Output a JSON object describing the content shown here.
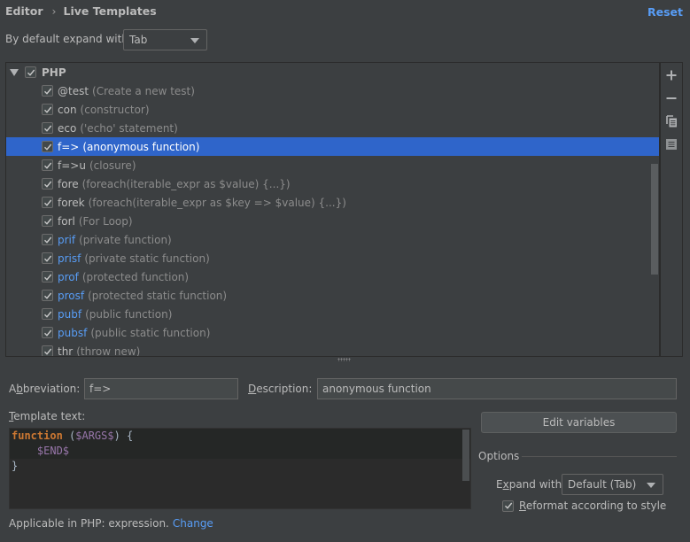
{
  "header": {
    "breadcrumb": [
      "Editor",
      "Live Templates"
    ],
    "separator": "›",
    "reset_label": "Reset"
  },
  "default_expand": {
    "label": "By default expand with",
    "value": "Tab"
  },
  "tree": {
    "group": {
      "label": "PHP",
      "expanded": true,
      "checked": true
    },
    "items": [
      {
        "abbr": "@test",
        "desc": "(Create a new test)",
        "checked": true,
        "color": "default"
      },
      {
        "abbr": "con",
        "desc": "(constructor)",
        "checked": true,
        "color": "default"
      },
      {
        "abbr": "eco",
        "desc": "('echo' statement)",
        "checked": true,
        "color": "default"
      },
      {
        "abbr": "f=>",
        "desc": "(anonymous function)",
        "checked": true,
        "color": "default",
        "selected": true
      },
      {
        "abbr": "f=>u",
        "desc": "(closure)",
        "checked": true,
        "color": "default"
      },
      {
        "abbr": "fore",
        "desc": "(foreach(iterable_expr as $value) {...})",
        "checked": true,
        "color": "default"
      },
      {
        "abbr": "forek",
        "desc": "(foreach(iterable_expr as $key => $value) {...})",
        "checked": true,
        "color": "default"
      },
      {
        "abbr": "forl",
        "desc": "(For Loop)",
        "checked": true,
        "color": "default"
      },
      {
        "abbr": "prif",
        "desc": "(private function)",
        "checked": true,
        "color": "blue"
      },
      {
        "abbr": "prisf",
        "desc": "(private static function)",
        "checked": true,
        "color": "blue"
      },
      {
        "abbr": "prof",
        "desc": "(protected function)",
        "checked": true,
        "color": "blue"
      },
      {
        "abbr": "prosf",
        "desc": "(protected static function)",
        "checked": true,
        "color": "blue"
      },
      {
        "abbr": "pubf",
        "desc": "(public function)",
        "checked": true,
        "color": "blue"
      },
      {
        "abbr": "pubsf",
        "desc": "(public static function)",
        "checked": true,
        "color": "blue"
      },
      {
        "abbr": "thr",
        "desc": "(throw new)",
        "checked": true,
        "color": "default"
      }
    ]
  },
  "toolbar": {
    "add_icon": "plus-icon",
    "remove_icon": "minus-icon",
    "copy_icon": "copy-icon",
    "restore_icon": "restore-icon"
  },
  "details": {
    "abbreviation_label_pre": "A",
    "abbreviation_label_u": "b",
    "abbreviation_label_post": "breviation:",
    "abbreviation_value": "f=>",
    "description_label_u": "D",
    "description_label_post": "escription:",
    "description_value": "anonymous function",
    "template_text_label_u": "T",
    "template_text_label_post": "emplate text:",
    "template_lines": {
      "l1_kw": "function",
      "l1_open": " (",
      "l1_var": "$ARGS$",
      "l1_close": ") {",
      "l2_indent": "    ",
      "l2_var": "$END$",
      "l3": "}"
    },
    "edit_variables_label": "Edit variables",
    "options_title": "Options",
    "expand_with_label_pre": "E",
    "expand_with_label_u": "x",
    "expand_with_label_post": "pand with",
    "expand_with_value": "Default (Tab)",
    "reformat_label_u": "R",
    "reformat_label_post": "eformat according to style",
    "reformat_checked": true,
    "applicable_text": "Applicable in PHP: expression.",
    "change_label": "Change"
  },
  "colors": {
    "accent": "#589df6",
    "selection": "#2f65ca",
    "background": "#3c3f41",
    "keyword": "#cc7832",
    "template_var": "#9876aa"
  }
}
